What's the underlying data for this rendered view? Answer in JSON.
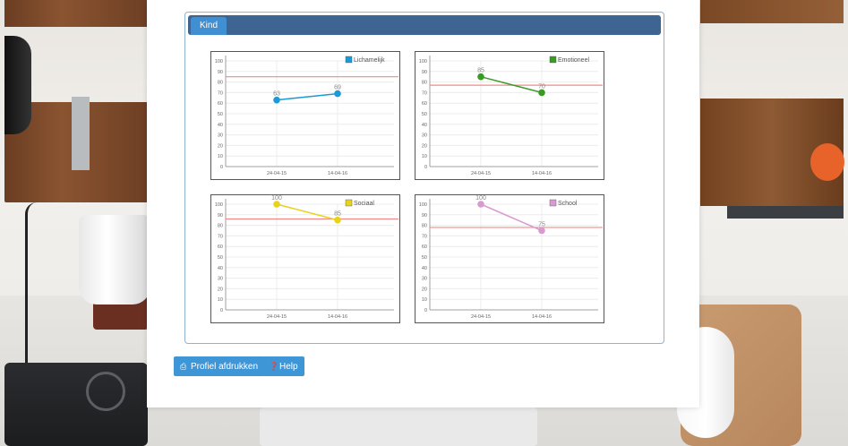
{
  "panel": {
    "tab_label": "Kind"
  },
  "charts": [
    {
      "legend": "Lichamelijk",
      "color": "#1a9ad6",
      "norm": 85,
      "points": [
        {
          "x": "24-04-15",
          "y": 63
        },
        {
          "x": "14-04-16",
          "y": 69
        }
      ]
    },
    {
      "legend": "Emotioneel",
      "color": "#3a9a25",
      "norm": 77,
      "points": [
        {
          "x": "24-04-15",
          "y": 85
        },
        {
          "x": "14-04-16",
          "y": 70
        }
      ]
    },
    {
      "legend": "Sociaal",
      "color": "#e8d21a",
      "norm": 86,
      "points": [
        {
          "x": "24-04-15",
          "y": 100
        },
        {
          "x": "14-04-16",
          "y": 85
        }
      ]
    },
    {
      "legend": "School",
      "color": "#d99ad0",
      "norm": 78,
      "points": [
        {
          "x": "24-04-15",
          "y": 100
        },
        {
          "x": "14-04-16",
          "y": 75
        }
      ]
    }
  ],
  "chart_data": [
    {
      "type": "line",
      "categories": [
        "24-04-15",
        "14-04-16"
      ],
      "series": [
        {
          "name": "Lichamelijk",
          "values": [
            63,
            69
          ]
        }
      ],
      "ylim": [
        0,
        100
      ],
      "yticks": [
        0,
        10,
        20,
        30,
        40,
        50,
        60,
        70,
        80,
        90,
        100
      ],
      "grid": true,
      "legend": "top-right"
    },
    {
      "type": "line",
      "categories": [
        "24-04-15",
        "14-04-16"
      ],
      "series": [
        {
          "name": "Emotioneel",
          "values": [
            85,
            70
          ]
        }
      ],
      "ylim": [
        0,
        100
      ],
      "yticks": [
        0,
        10,
        20,
        30,
        40,
        50,
        60,
        70,
        80,
        90,
        100
      ],
      "grid": true,
      "legend": "top-right"
    },
    {
      "type": "line",
      "categories": [
        "24-04-15",
        "14-04-16"
      ],
      "series": [
        {
          "name": "Sociaal",
          "values": [
            100,
            85
          ]
        }
      ],
      "ylim": [
        0,
        100
      ],
      "yticks": [
        0,
        10,
        20,
        30,
        40,
        50,
        60,
        70,
        80,
        90,
        100
      ],
      "grid": true,
      "legend": "top-right"
    },
    {
      "type": "line",
      "categories": [
        "24-04-15",
        "14-04-16"
      ],
      "series": [
        {
          "name": "School",
          "values": [
            100,
            75
          ]
        }
      ],
      "ylim": [
        0,
        100
      ],
      "yticks": [
        0,
        10,
        20,
        30,
        40,
        50,
        60,
        70,
        80,
        90,
        100
      ],
      "grid": true,
      "legend": "top-right"
    }
  ],
  "buttons": {
    "print_label": "Profiel afdrukken",
    "print_icon": "printer-icon",
    "help_label": "Help",
    "help_icon": "question-circle-icon"
  },
  "colors": {
    "norm_line": "#f08a8a",
    "panel_header": "#3e6591",
    "tab": "#3f8fd2",
    "button": "#3f96d6"
  }
}
